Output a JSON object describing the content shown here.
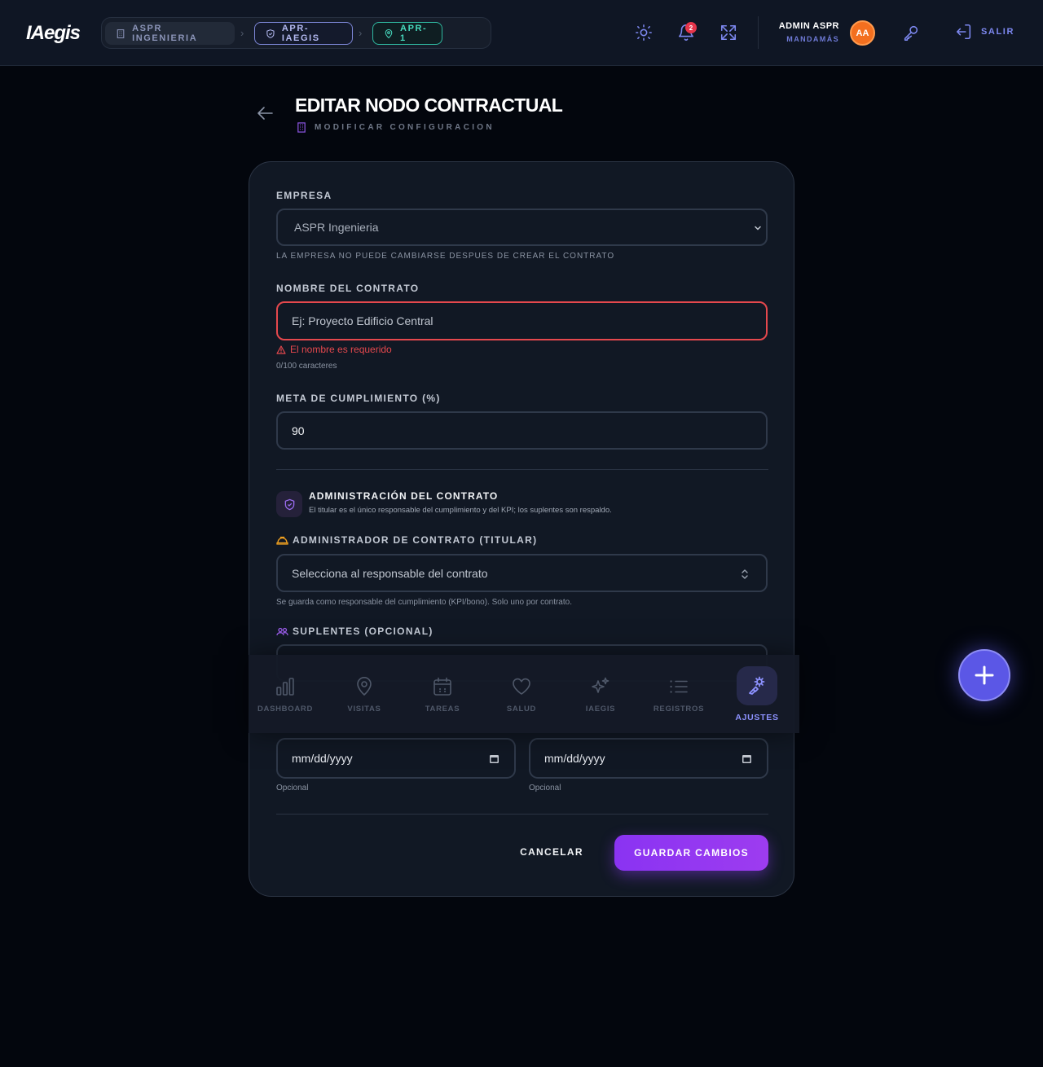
{
  "header": {
    "logo": "IAegis",
    "breadcrumbs": [
      {
        "label": "ASPR INGENIERIA",
        "icon": "building-icon"
      },
      {
        "label": "APR-IAEGIS",
        "icon": "shield-icon"
      },
      {
        "label": "APR-1",
        "icon": "map-pin-icon"
      }
    ],
    "notifications_count": "2",
    "user": {
      "name": "ADMIN ASPR",
      "role": "MANDAMÁS",
      "initials": "AA"
    },
    "logout_label": "SALIR"
  },
  "page": {
    "title": "EDITAR NODO CONTRACTUAL",
    "subtitle": "MODIFICAR CONFIGURACION"
  },
  "form": {
    "empresa": {
      "label": "EMPRESA",
      "value": "ASPR Ingenieria",
      "hint": "LA EMPRESA NO PUEDE CAMBIARSE DESPUES DE CREAR EL CONTRATO"
    },
    "nombre": {
      "label": "NOMBRE DEL CONTRATO",
      "placeholder": "Ej: Proyecto Edificio Central",
      "error": "El nombre es requerido",
      "counter": "0/100 caracteres"
    },
    "meta": {
      "label": "META DE CUMPLIMIENTO (%)",
      "value": "90"
    },
    "admin_section": {
      "title": "ADMINISTRACIÓN DEL CONTRATO",
      "description": "El titular es el único responsable del cumplimiento y del KPI; los suplentes son respaldo."
    },
    "titular": {
      "label": "ADMINISTRADOR DE CONTRATO (TITULAR)",
      "placeholder": "Selecciona al responsable del contrato",
      "hint": "Se guarda como responsable del cumplimiento (KPI/bono). Solo uno por contrato."
    },
    "suplentes": {
      "label": "SUPLENTES (OPCIONAL)"
    },
    "dates": [
      {
        "placeholder": "mm/dd/yyyy",
        "hint": "Opcional"
      },
      {
        "placeholder": "mm/dd/yyyy",
        "hint": "Opcional"
      }
    ],
    "cancel_label": "CANCELAR",
    "save_label": "GUARDAR CAMBIOS"
  },
  "bottom_nav": [
    {
      "label": "DASHBOARD",
      "icon": "bar-chart-icon",
      "active": false
    },
    {
      "label": "VISITAS",
      "icon": "map-pin-icon",
      "active": false
    },
    {
      "label": "TAREAS",
      "icon": "calendar-icon",
      "active": false
    },
    {
      "label": "SALUD",
      "icon": "heart-icon",
      "active": false
    },
    {
      "label": "IAEGIS",
      "icon": "sparkles-icon",
      "active": false
    },
    {
      "label": "REGISTROS",
      "icon": "list-icon",
      "active": false
    },
    {
      "label": "AJUSTES",
      "icon": "settings-icon",
      "active": true
    }
  ],
  "colors": {
    "accent": "#7d88f0",
    "primary_button": "#8a33f2",
    "error": "#e5484d",
    "avatar": "#f36f1f"
  }
}
